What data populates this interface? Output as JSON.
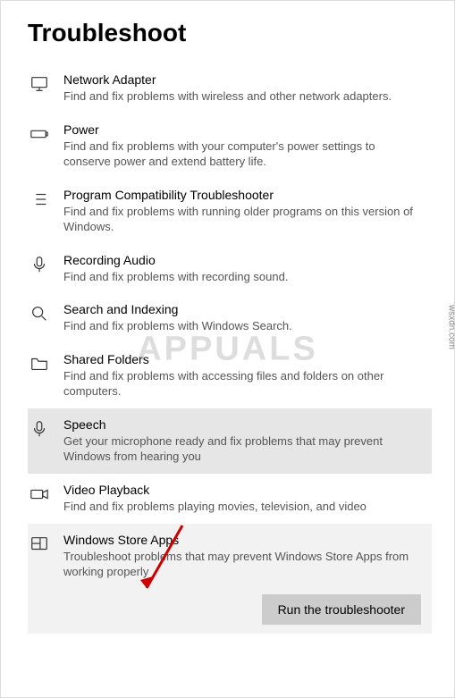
{
  "pageTitle": "Troubleshoot",
  "items": [
    {
      "title": "Network Adapter",
      "desc": "Find and fix problems with wireless and other network adapters."
    },
    {
      "title": "Power",
      "desc": "Find and fix problems with your computer's power settings to conserve power and extend battery life."
    },
    {
      "title": "Program Compatibility Troubleshooter",
      "desc": "Find and fix problems with running older programs on this version of Windows."
    },
    {
      "title": "Recording Audio",
      "desc": "Find and fix problems with recording sound."
    },
    {
      "title": "Search and Indexing",
      "desc": "Find and fix problems with Windows Search."
    },
    {
      "title": "Shared Folders",
      "desc": "Find and fix problems with accessing files and folders on other computers."
    },
    {
      "title": "Speech",
      "desc": "Get your microphone ready and fix problems that may prevent Windows from hearing you"
    },
    {
      "title": "Video Playback",
      "desc": "Find and fix problems playing movies, television, and video"
    },
    {
      "title": "Windows Store Apps",
      "desc": "Troubleshoot problems that may prevent Windows Store Apps from working properly"
    }
  ],
  "runButton": "Run the troubleshooter",
  "watermark": "APPUALS",
  "sideText": "wsxdn.com"
}
